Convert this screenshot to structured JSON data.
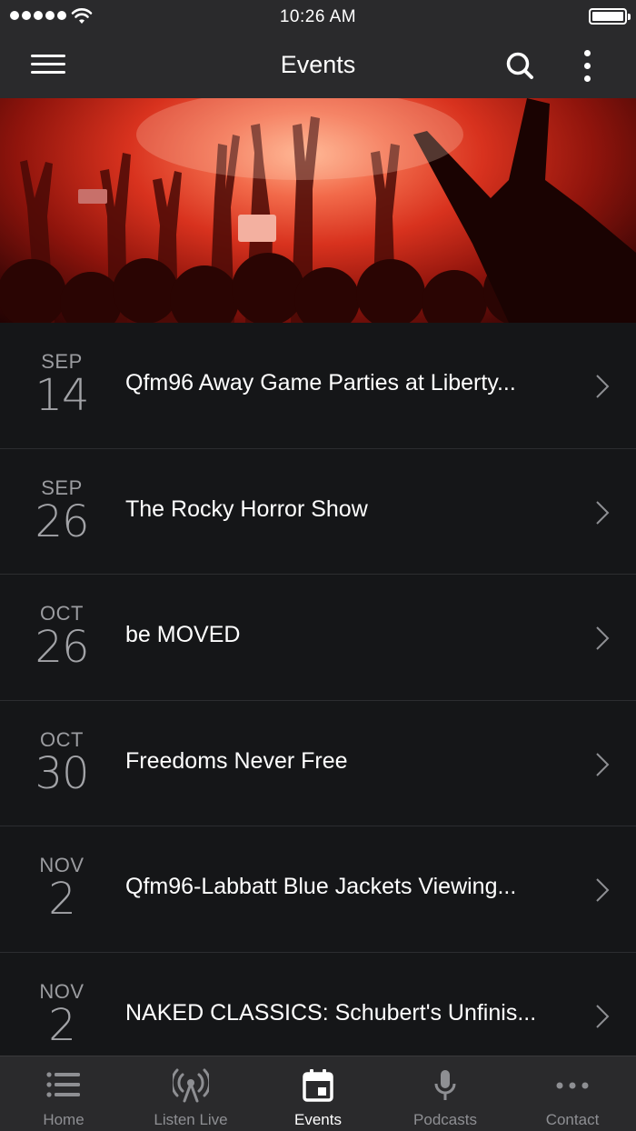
{
  "status_bar": {
    "time": "10:26 AM"
  },
  "app_bar": {
    "title": "Events",
    "icons": [
      "menu-icon",
      "search-icon",
      "more-vertical-icon"
    ]
  },
  "hero": {
    "image": "concert-crowd-photo",
    "accent_color": "#d8321e"
  },
  "events": [
    {
      "month": "SEP",
      "day": "14",
      "title": "Qfm96 Away Game Parties at Liberty..."
    },
    {
      "month": "SEP",
      "day": "26",
      "title": "The Rocky Horror Show"
    },
    {
      "month": "OCT",
      "day": "26",
      "title": "be MOVED"
    },
    {
      "month": "OCT",
      "day": "30",
      "title": "Freedoms Never Free"
    },
    {
      "month": "NOV",
      "day": "2",
      "title": "Qfm96-Labbatt Blue Jackets Viewing..."
    },
    {
      "month": "NOV",
      "day": "2",
      "title": "NAKED CLASSICS: Schubert's Unfinis..."
    }
  ],
  "tab_bar": {
    "tabs": [
      {
        "label": "Home",
        "icon": "list-icon",
        "active": false
      },
      {
        "label": "Listen Live",
        "icon": "radio-tower-icon",
        "active": false
      },
      {
        "label": "Events",
        "icon": "calendar-icon",
        "active": true
      },
      {
        "label": "Podcasts",
        "icon": "microphone-icon",
        "active": false
      },
      {
        "label": "Contact",
        "icon": "ellipsis-icon",
        "active": false
      }
    ]
  },
  "colors": {
    "background": "#151618",
    "bar": "#2a2a2c",
    "divider": "#2c2d30",
    "muted_text": "#9b9ca0",
    "active_tab": "#ffffff",
    "inactive_tab": "#8e8f93"
  }
}
